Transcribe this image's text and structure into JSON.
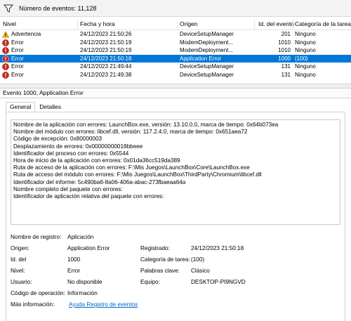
{
  "toolbar": {
    "event_count_label": "Número de eventos: 11,128"
  },
  "grid": {
    "columns": [
      "Nivel",
      "Fecha y hora",
      "Origen",
      "Id. del evento",
      "Categoría de la tarea"
    ],
    "rows": [
      {
        "level": "Advertencia",
        "level_icon": "warning-icon",
        "datetime": "24/12/2023 21:50:26",
        "source": "DeviceSetupManager",
        "id": "201",
        "category": "Ninguno"
      },
      {
        "level": "Error",
        "level_icon": "error-icon",
        "datetime": "24/12/2023 21:50:19",
        "source": "ModemDeployment...",
        "id": "1010",
        "category": "Ninguno"
      },
      {
        "level": "Error",
        "level_icon": "error-icon",
        "datetime": "24/12/2023 21:50:19",
        "source": "ModemDeployment...",
        "id": "1010",
        "category": "Ninguno"
      },
      {
        "level": "Error",
        "level_icon": "error-icon",
        "datetime": "24/12/2023 21:50:18",
        "source": "Application Error",
        "id": "1000",
        "category": "(100)",
        "selected": true
      },
      {
        "level": "Error",
        "level_icon": "error-icon",
        "datetime": "24/12/2023 21:49:44",
        "source": "DeviceSetupManager",
        "id": "131",
        "category": "Ninguno"
      },
      {
        "level": "Error",
        "level_icon": "error-icon",
        "datetime": "24/12/2023 21:49:38",
        "source": "DeviceSetupManager",
        "id": "131",
        "category": "Ninguno"
      }
    ]
  },
  "detail": {
    "title": "Evento 1000, Application Error",
    "tabs": [
      "General",
      "Detalles"
    ],
    "description": [
      "Nombre de la aplicación con errores: LaunchBox.exe, versión: 13.10.0.0, marca de tiempo: 0x64b073ea",
      "Nombre del módulo con errores: libcef.dll, versión: 117.2.4.0, marca de tiempo: 0x651aea72",
      "Código de excepción: 0x80000003",
      "Desplazamiento de errores: 0x00000000018bbeee",
      "Identificador del proceso con errores: 0x5544",
      "Hora de inicio de la aplicación con errores: 0x01da36cc519da389",
      "Ruta de acceso de la aplicación con errores: F:\\Mis Juegos\\LaunchBox\\Core\\LaunchBox.exe",
      "Ruta de acceso del módulo con errores: F:\\Mis Juegos\\LaunchBox\\ThirdParty\\Chromium\\libcef.dll",
      "Identificador del informe: 5c490ba6-8a06-406a-abac-273fbaeaa64a",
      "Nombre completo del paquete con errores:",
      "Identificador de aplicación relativa del paquete con errores:"
    ],
    "labels": {
      "log_name": "Nombre de registro:",
      "source": "Origen:",
      "event_id": "Id. del",
      "level": "Nivel:",
      "user": "Usuario:",
      "opcode": "Código de operación:",
      "more_info": "Más información:",
      "recorded": "Registrado:",
      "task_category": "Categoría de tarea:",
      "keywords": "Palabras clave:",
      "computer": "Equipo:"
    },
    "values": {
      "log_name": "Aplicación",
      "source": "Application Error",
      "event_id": "1000",
      "level": "Error",
      "user": "No disponible",
      "opcode": "Información",
      "more_info_link": "Ayuda Registro de eventos",
      "recorded": "24/12/2023 21:50:18",
      "task_category": "(100)",
      "keywords": "Clásico",
      "computer": "DESKTOP-PI9NGVD"
    }
  }
}
